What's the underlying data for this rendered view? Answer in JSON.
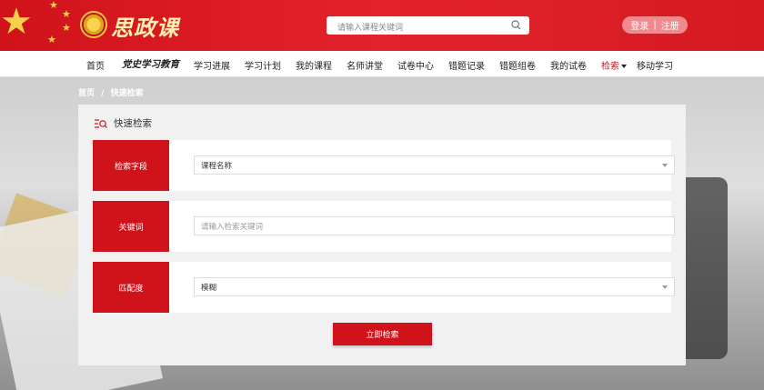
{
  "header": {
    "brand": "思政课",
    "search_placeholder": "请输入课程关键词",
    "login_label": "登录",
    "separator": "|",
    "register_label": "注册"
  },
  "nav": {
    "items": [
      {
        "label": "首页"
      },
      {
        "label": "党史学习教育"
      },
      {
        "label": "学习进展"
      },
      {
        "label": "学习计划"
      },
      {
        "label": "我的课程"
      },
      {
        "label": "名师讲堂"
      },
      {
        "label": "试卷中心"
      },
      {
        "label": "错题记录"
      },
      {
        "label": "错题组卷"
      },
      {
        "label": "我的试卷"
      },
      {
        "label": "检索"
      },
      {
        "label": "移动学习"
      }
    ],
    "active_index": 10
  },
  "breadcrumb": {
    "home": "首页",
    "separator": "/",
    "current": "快速检索"
  },
  "panel": {
    "title": "快速检索",
    "rows": [
      {
        "label": "检索字段",
        "value": "课程名称",
        "kind": "select"
      },
      {
        "label": "关键词",
        "placeholder": "请输入检索关键词",
        "kind": "input"
      },
      {
        "label": "匹配度",
        "value": "模糊",
        "kind": "select"
      }
    ],
    "submit_label": "立即检索"
  },
  "colors": {
    "accent": "#d0121a",
    "auth_button": "#f08a8e",
    "panel_bg": "#f1f1f1"
  },
  "icons": {
    "search": "search-icon",
    "panel": "search-list-icon",
    "dropdown": "chevron-down-icon"
  }
}
